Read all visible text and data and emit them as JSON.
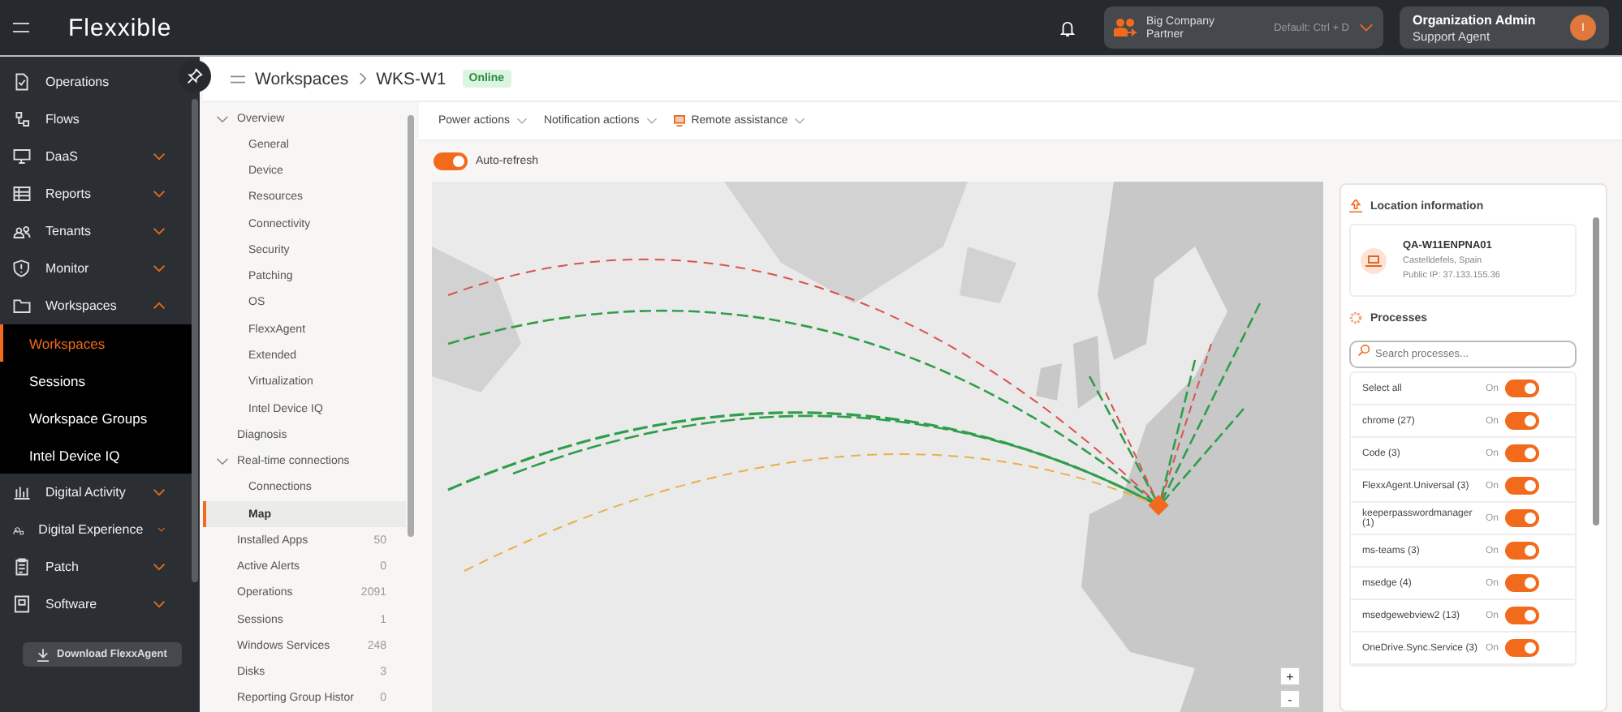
{
  "app": {
    "logo": "Flexxible"
  },
  "header": {
    "org": {
      "name": "Big Company",
      "role": "Partner",
      "shortcut": "Default: Ctrl + D"
    },
    "user": {
      "name": "Organization Admin",
      "role": "Support Agent",
      "initial": "I"
    }
  },
  "nav": [
    {
      "label": "Operations",
      "kind": "link"
    },
    {
      "label": "Flows",
      "kind": "link"
    },
    {
      "label": "DaaS",
      "kind": "group",
      "expanded": false
    },
    {
      "label": "Reports",
      "kind": "group",
      "expanded": false
    },
    {
      "label": "Tenants",
      "kind": "group",
      "expanded": false
    },
    {
      "label": "Monitor",
      "kind": "group",
      "expanded": false
    },
    {
      "label": "Workspaces",
      "kind": "group",
      "expanded": true,
      "children": [
        {
          "label": "Workspaces",
          "selected": true
        },
        {
          "label": "Sessions",
          "selected": false
        },
        {
          "label": "Workspace Groups",
          "selected": false
        },
        {
          "label": "Intel Device IQ",
          "selected": false
        }
      ]
    },
    {
      "label": "Digital Activity",
      "kind": "group",
      "expanded": false
    },
    {
      "label": "Digital Experience",
      "kind": "group",
      "expanded": false
    },
    {
      "label": "Patch",
      "kind": "group",
      "expanded": false
    },
    {
      "label": "Software",
      "kind": "group",
      "expanded": false
    }
  ],
  "download_button": "Download FlexxAgent",
  "breadcrumb": [
    "Workspaces",
    "WKS-W1"
  ],
  "status_badge": "Online",
  "subnav": [
    {
      "label": "Overview",
      "expanded": true,
      "children": [
        {
          "label": "General",
          "selected": false
        },
        {
          "label": "Device",
          "selected": false
        },
        {
          "label": "Resources",
          "selected": false
        },
        {
          "label": "Connectivity",
          "selected": false
        },
        {
          "label": "Security",
          "selected": false
        },
        {
          "label": "Patching",
          "selected": false
        },
        {
          "label": "OS",
          "selected": false
        },
        {
          "label": "FlexxAgent",
          "selected": false
        },
        {
          "label": "Extended",
          "selected": false
        },
        {
          "label": "Virtualization",
          "selected": false
        },
        {
          "label": "Intel Device IQ",
          "selected": false
        }
      ]
    },
    {
      "label": "Diagnosis",
      "selected": false
    },
    {
      "label": "Real-time connections",
      "expanded": true,
      "children": [
        {
          "label": "Connections",
          "selected": false
        },
        {
          "label": "Map",
          "selected": true
        }
      ]
    },
    {
      "label": "Installed Apps",
      "count": "50",
      "selected": false
    },
    {
      "label": "Active Alerts",
      "count": "0",
      "selected": false
    },
    {
      "label": "Operations",
      "count": "2091",
      "selected": false
    },
    {
      "label": "Sessions",
      "count": "1",
      "selected": false
    },
    {
      "label": "Windows Services",
      "count": "248",
      "selected": false
    },
    {
      "label": "Disks",
      "count": "3",
      "selected": false
    },
    {
      "label": "Reporting Group Histor",
      "count": "0",
      "selected": false
    }
  ],
  "actions": [
    {
      "label": "Power actions",
      "kind": "plain"
    },
    {
      "label": "Notification actions",
      "kind": "plain"
    },
    {
      "label": "Remote assistance",
      "kind": "remote"
    }
  ],
  "auto_refresh": {
    "label": "Auto-refresh",
    "on": true
  },
  "map": {
    "zoom_in": "+",
    "zoom_out": "-"
  },
  "location": {
    "title": "Location information",
    "device": "QA-W11ENPNA01",
    "place": "Castelldefels, Spain",
    "ip": "Public IP: 37.133.155.36"
  },
  "processes": {
    "title": "Processes",
    "search_placeholder": "Search processes...",
    "items": [
      {
        "name": "Select all",
        "state": "On",
        "on": true
      },
      {
        "name": "chrome (27)",
        "state": "On",
        "on": true
      },
      {
        "name": "Code (3)",
        "state": "On",
        "on": true
      },
      {
        "name": "FlexxAgent.Universal (3)",
        "state": "On",
        "on": true
      },
      {
        "name": "keeperpasswordmanager (1)",
        "state": "On",
        "on": true
      },
      {
        "name": "ms-teams (3)",
        "state": "On",
        "on": true
      },
      {
        "name": "msedge (4)",
        "state": "On",
        "on": true
      },
      {
        "name": "msedgewebview2 (13)",
        "state": "On",
        "on": true
      },
      {
        "name": "OneDrive.Sync.Service (3)",
        "state": "On",
        "on": true
      }
    ]
  }
}
